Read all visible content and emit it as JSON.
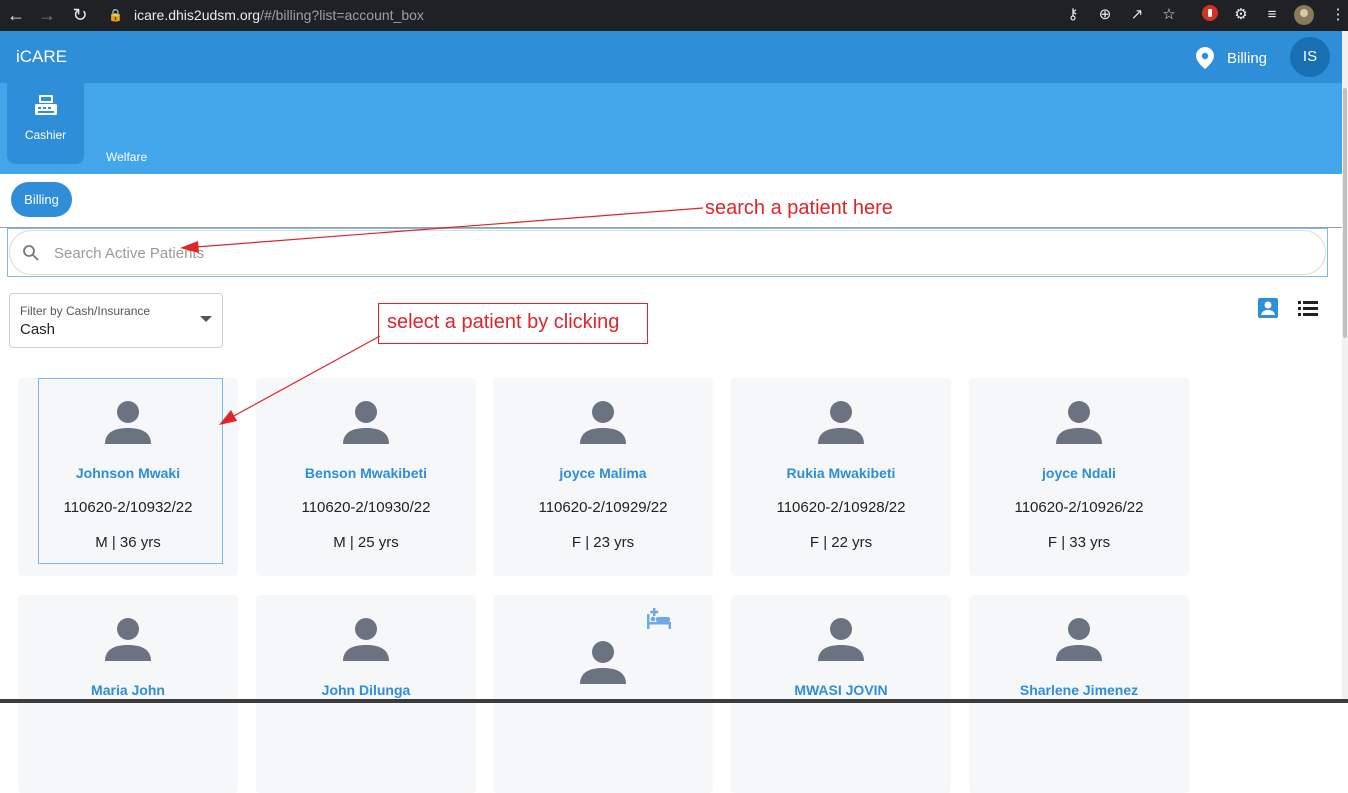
{
  "browser": {
    "url_host": "icare.dhis2udsm.org",
    "url_rest": "/#/billing?list=account_box"
  },
  "app": {
    "brand": "iCARE",
    "location_label": "Billing",
    "user_initials": "IS"
  },
  "modules": {
    "cashier_label": "Cashier",
    "welfare_label": "Welfare"
  },
  "billing_pill": "Billing",
  "search": {
    "placeholder": "Search Active Patients"
  },
  "filter": {
    "label": "Filter by Cash/Insurance",
    "value": "Cash"
  },
  "annotations": {
    "search_hint": "search a patient here",
    "select_hint": "select a patient by clicking"
  },
  "patients": [
    {
      "name": "Johnson Mwaki",
      "id": "110620-2/10932/22",
      "info": "M | 36 yrs"
    },
    {
      "name": "Benson Mwakibeti",
      "id": "110620-2/10930/22",
      "info": "M | 25 yrs"
    },
    {
      "name": "joyce Malima",
      "id": "110620-2/10929/22",
      "info": "F | 23 yrs"
    },
    {
      "name": "Rukia Mwakibeti",
      "id": "110620-2/10928/22",
      "info": "F | 22 yrs"
    },
    {
      "name": "joyce Ndali",
      "id": "110620-2/10926/22",
      "info": "F | 33 yrs"
    },
    {
      "name": "Maria John",
      "id": "",
      "info": ""
    },
    {
      "name": "John Dilunga",
      "id": "",
      "info": ""
    },
    {
      "name": "",
      "id": "",
      "info": ""
    },
    {
      "name": "MWASI JOVIN",
      "id": "",
      "info": ""
    },
    {
      "name": "Sharlene Jimenez",
      "id": "",
      "info": ""
    }
  ],
  "colors": {
    "appbar": "#2e8ed8",
    "modbar": "#43a6eb",
    "accent": "#2e8ed8",
    "annotation": "#e0242a"
  }
}
